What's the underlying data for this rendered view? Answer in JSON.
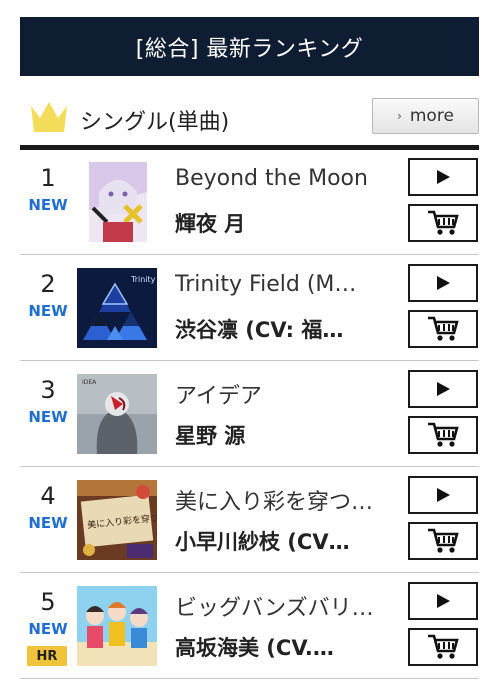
{
  "header": {
    "title": "[総合] 最新ランキング"
  },
  "section": {
    "title": "シングル(単曲)",
    "more_label": "more",
    "more_chevron": "›",
    "icon": "crown-icon"
  },
  "colors": {
    "header_bg": "#0f1d33",
    "new_badge": "#1f6fd1",
    "hr_badge": "#f0c33c",
    "crown": "#f3dc5a"
  },
  "rankings": [
    {
      "rank": "1",
      "new": "NEW",
      "title": "Beyond the Moon",
      "artist": "輝夜 月",
      "hr": ""
    },
    {
      "rank": "2",
      "new": "NEW",
      "title": "Trinity Field (M…",
      "artist": "渋谷凛 (CV: 福…",
      "hr": ""
    },
    {
      "rank": "3",
      "new": "NEW",
      "title": "アイデア",
      "artist": "星野 源",
      "hr": ""
    },
    {
      "rank": "4",
      "new": "NEW",
      "title": "美に入り彩を穿つ…",
      "artist": "小早川紗枝 (CV…",
      "hr": ""
    },
    {
      "rank": "5",
      "new": "NEW",
      "title": "ビッグバンズバリ…",
      "artist": "高坂海美 (CV.…",
      "hr": "HR"
    }
  ],
  "cover_art": {
    "trinity_text": "Trinity Field",
    "idea_text": "IDEA",
    "sae_text": "美に入り彩を穿つ"
  }
}
